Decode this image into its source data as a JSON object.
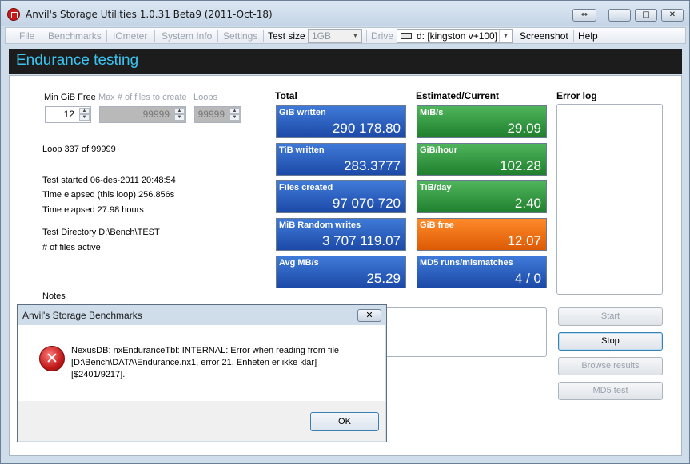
{
  "window": {
    "title": "Anvil's Storage Utilities 1.0.31 Beta9 (2011-Oct-18)",
    "title_buttons": {
      "restore": "⇔",
      "minimize": "─",
      "maximize": "□",
      "close": "✕"
    }
  },
  "menubar": {
    "file": "File",
    "benchmarks": "Benchmarks",
    "iometer": "IOmeter",
    "system_info": "System Info",
    "settings": "Settings",
    "test_size_label": "Test size",
    "test_size_value": "1GB",
    "drive_label": "Drive",
    "drive_value": "d: [kingston v+100]",
    "screenshot": "Screenshot",
    "help": "Help"
  },
  "header": {
    "title": "Endurance testing"
  },
  "settings": {
    "min_gib_free_label": "Min GiB Free",
    "min_gib_free_value": "12",
    "max_files_label": "Max # of files to create",
    "max_files_value": "99999",
    "loops_label": "Loops",
    "loops_value": "99999"
  },
  "status": {
    "loop": "Loop 337 of 99999",
    "test_started": "Test started 06-des-2011 20:48:54",
    "time_elapsed_loop": "Time elapsed (this loop) 256.856s",
    "time_elapsed": "Time elapsed 27.98 hours",
    "test_directory": "Test Directory D:\\Bench\\TEST",
    "files_active": "# of files active",
    "notes_label": "Notes"
  },
  "totals": {
    "heading": "Total",
    "tiles": [
      {
        "label": "GiB written",
        "value": "290 178.80"
      },
      {
        "label": "TiB written",
        "value": "283.3777"
      },
      {
        "label": "Files created",
        "value": "97 070 720"
      },
      {
        "label": "MiB Random writes",
        "value": "3 707 119.07"
      },
      {
        "label": "Avg MB/s",
        "value": "25.29"
      }
    ]
  },
  "estimated": {
    "heading": "Estimated/Current",
    "tiles": [
      {
        "label": "MiB/s",
        "value": "29.09"
      },
      {
        "label": "GiB/hour",
        "value": "102.28"
      },
      {
        "label": "TiB/day",
        "value": "2.40"
      },
      {
        "label": "GiB free",
        "value": "12.07"
      },
      {
        "label": "MD5 runs/mismatches",
        "value": "4 / 0"
      }
    ]
  },
  "error_log": {
    "heading": "Error log"
  },
  "buttons": {
    "start": "Start",
    "stop": "Stop",
    "browse_results": "Browse results",
    "md5_test": "MD5 test"
  },
  "dialog": {
    "title": "Anvil's Storage Benchmarks",
    "close": "✕",
    "icon": "✕",
    "message_line1": "NexusDB: nxEnduranceTbl: INTERNAL: Error when reading from file",
    "message_line2": "[D:\\Bench\\DATA\\Endurance.nx1, error 21, Enheten er ikke klar]",
    "message_line3": "[$2401/9217].",
    "ok": "OK"
  },
  "colors": {
    "tile_blue": "#1c49a7",
    "tile_green": "#1f7f2d",
    "tile_orange": "#dc5a05",
    "header_text": "#3bc3f0"
  }
}
